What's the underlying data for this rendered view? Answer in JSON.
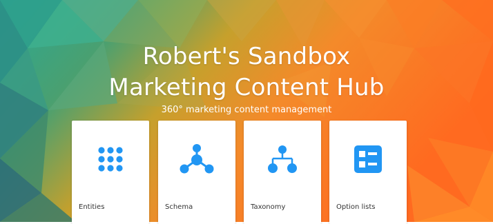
{
  "hero": {
    "title_line1": "Robert's Sandbox",
    "title_line2": "Marketing Content Hub",
    "tagline": "360° marketing content management"
  },
  "cards": [
    {
      "label": "Entities",
      "icon": "grid-dots-icon"
    },
    {
      "label": "Schema",
      "icon": "schema-nodes-icon"
    },
    {
      "label": "Taxonomy",
      "icon": "taxonomy-tree-icon"
    },
    {
      "label": "Option lists",
      "icon": "option-list-icon"
    }
  ],
  "colors": {
    "icon_blue": "#2196f3",
    "card_bg": "#ffffff",
    "teal": "#2bb39a",
    "orange": "#ff6a1f"
  }
}
